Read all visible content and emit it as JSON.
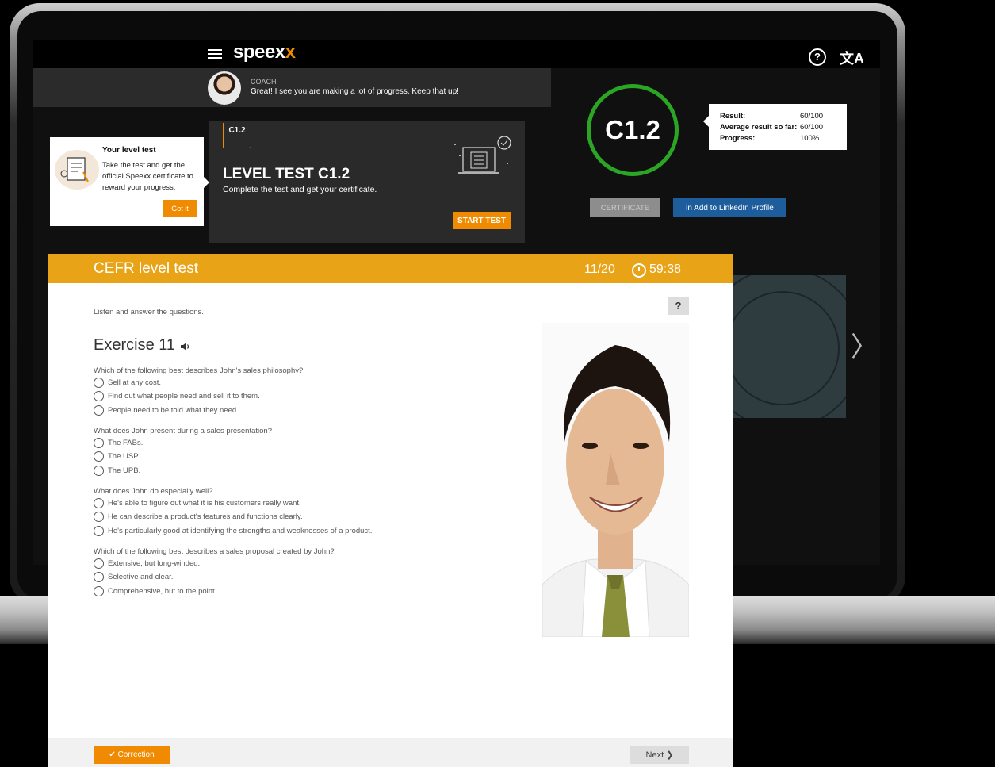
{
  "app": {
    "brand": "speex",
    "brand_accent": "x",
    "help_icon": "?",
    "language_icon": "文A"
  },
  "coach": {
    "label": "COACH",
    "message": "Great! I see you are making a lot of progress. Keep that up!"
  },
  "tip": {
    "title": "Your level test",
    "text": "Take the test and get the official Speexx certificate to reward your progress.",
    "button": "Got it"
  },
  "level_test": {
    "badge": "C1.2",
    "title": "LEVEL TEST C1.2",
    "subtitle": "Complete the test and get your certificate.",
    "start_button": "START TEST"
  },
  "result": {
    "level": "C1.2",
    "rows": [
      {
        "label": "Result:",
        "value": "60/100"
      },
      {
        "label": "Average result so far:",
        "value": "60/100"
      },
      {
        "label": "Progress:",
        "value": "100%"
      }
    ],
    "certificate_button": "CERTIFICATE",
    "linkedin_button": "in  Add to LinkedIn Profile"
  },
  "modal": {
    "title": "CEFR level test",
    "counter": "11/20",
    "timer": "59:38",
    "help_button": "?",
    "instruction": "Listen and answer the questions.",
    "exercise_title": "Exercise 11",
    "questions": [
      {
        "text": "Which of the following best describes John's sales philosophy?",
        "options": [
          "Sell at any cost.",
          "Find out what people need and sell it to them.",
          "People need to be told what they need."
        ]
      },
      {
        "text": "What does John present during a sales presentation?",
        "options": [
          "The FABs.",
          "The USP.",
          "The UPB."
        ]
      },
      {
        "text": "What does John do especially well?",
        "options": [
          "He's able to figure out what it is his customers really want.",
          "He can describe a product's features and functions clearly.",
          "He's particularly good at identifying the strengths and weaknesses of a product."
        ]
      },
      {
        "text": "Which of the following best describes a sales proposal created by John?",
        "options": [
          "Extensive, but long-winded.",
          "Selective and clear.",
          "Comprehensive, but to the point."
        ]
      }
    ],
    "correction_button": "✔  Correction",
    "next_button": "Next  ❯"
  },
  "colors": {
    "accent_orange": "#f08a00",
    "header_yellow": "#e8a317",
    "success_green": "#2ba524",
    "linkedin_blue": "#1d5d9b"
  }
}
